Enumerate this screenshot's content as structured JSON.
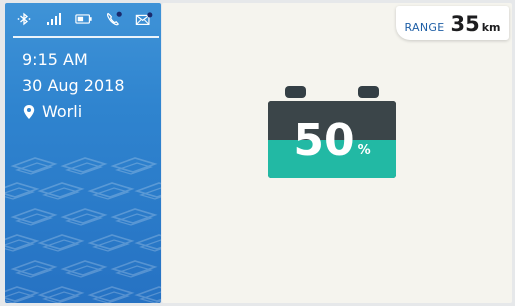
{
  "status_bar": {
    "icons": [
      "bluetooth-icon",
      "signal-icon",
      "battery-status-icon",
      "phone-icon",
      "mail-icon"
    ],
    "phone_notification": true,
    "mail_notification": true
  },
  "info": {
    "time": "9:15 AM",
    "date": "30 Aug 2018",
    "location": "Worli"
  },
  "range": {
    "label": "RANGE",
    "value": "35",
    "unit": "km"
  },
  "battery": {
    "level_percent": 50,
    "value_text": "50",
    "unit": "%"
  },
  "colors": {
    "sidebar": "#2f84cf",
    "panel": "#f5f4ee",
    "battery_fill": "#22b9a4",
    "battery_empty": "#3b4549",
    "range_label": "#1f5fa6",
    "notification_dot": "#1a2a6c"
  }
}
